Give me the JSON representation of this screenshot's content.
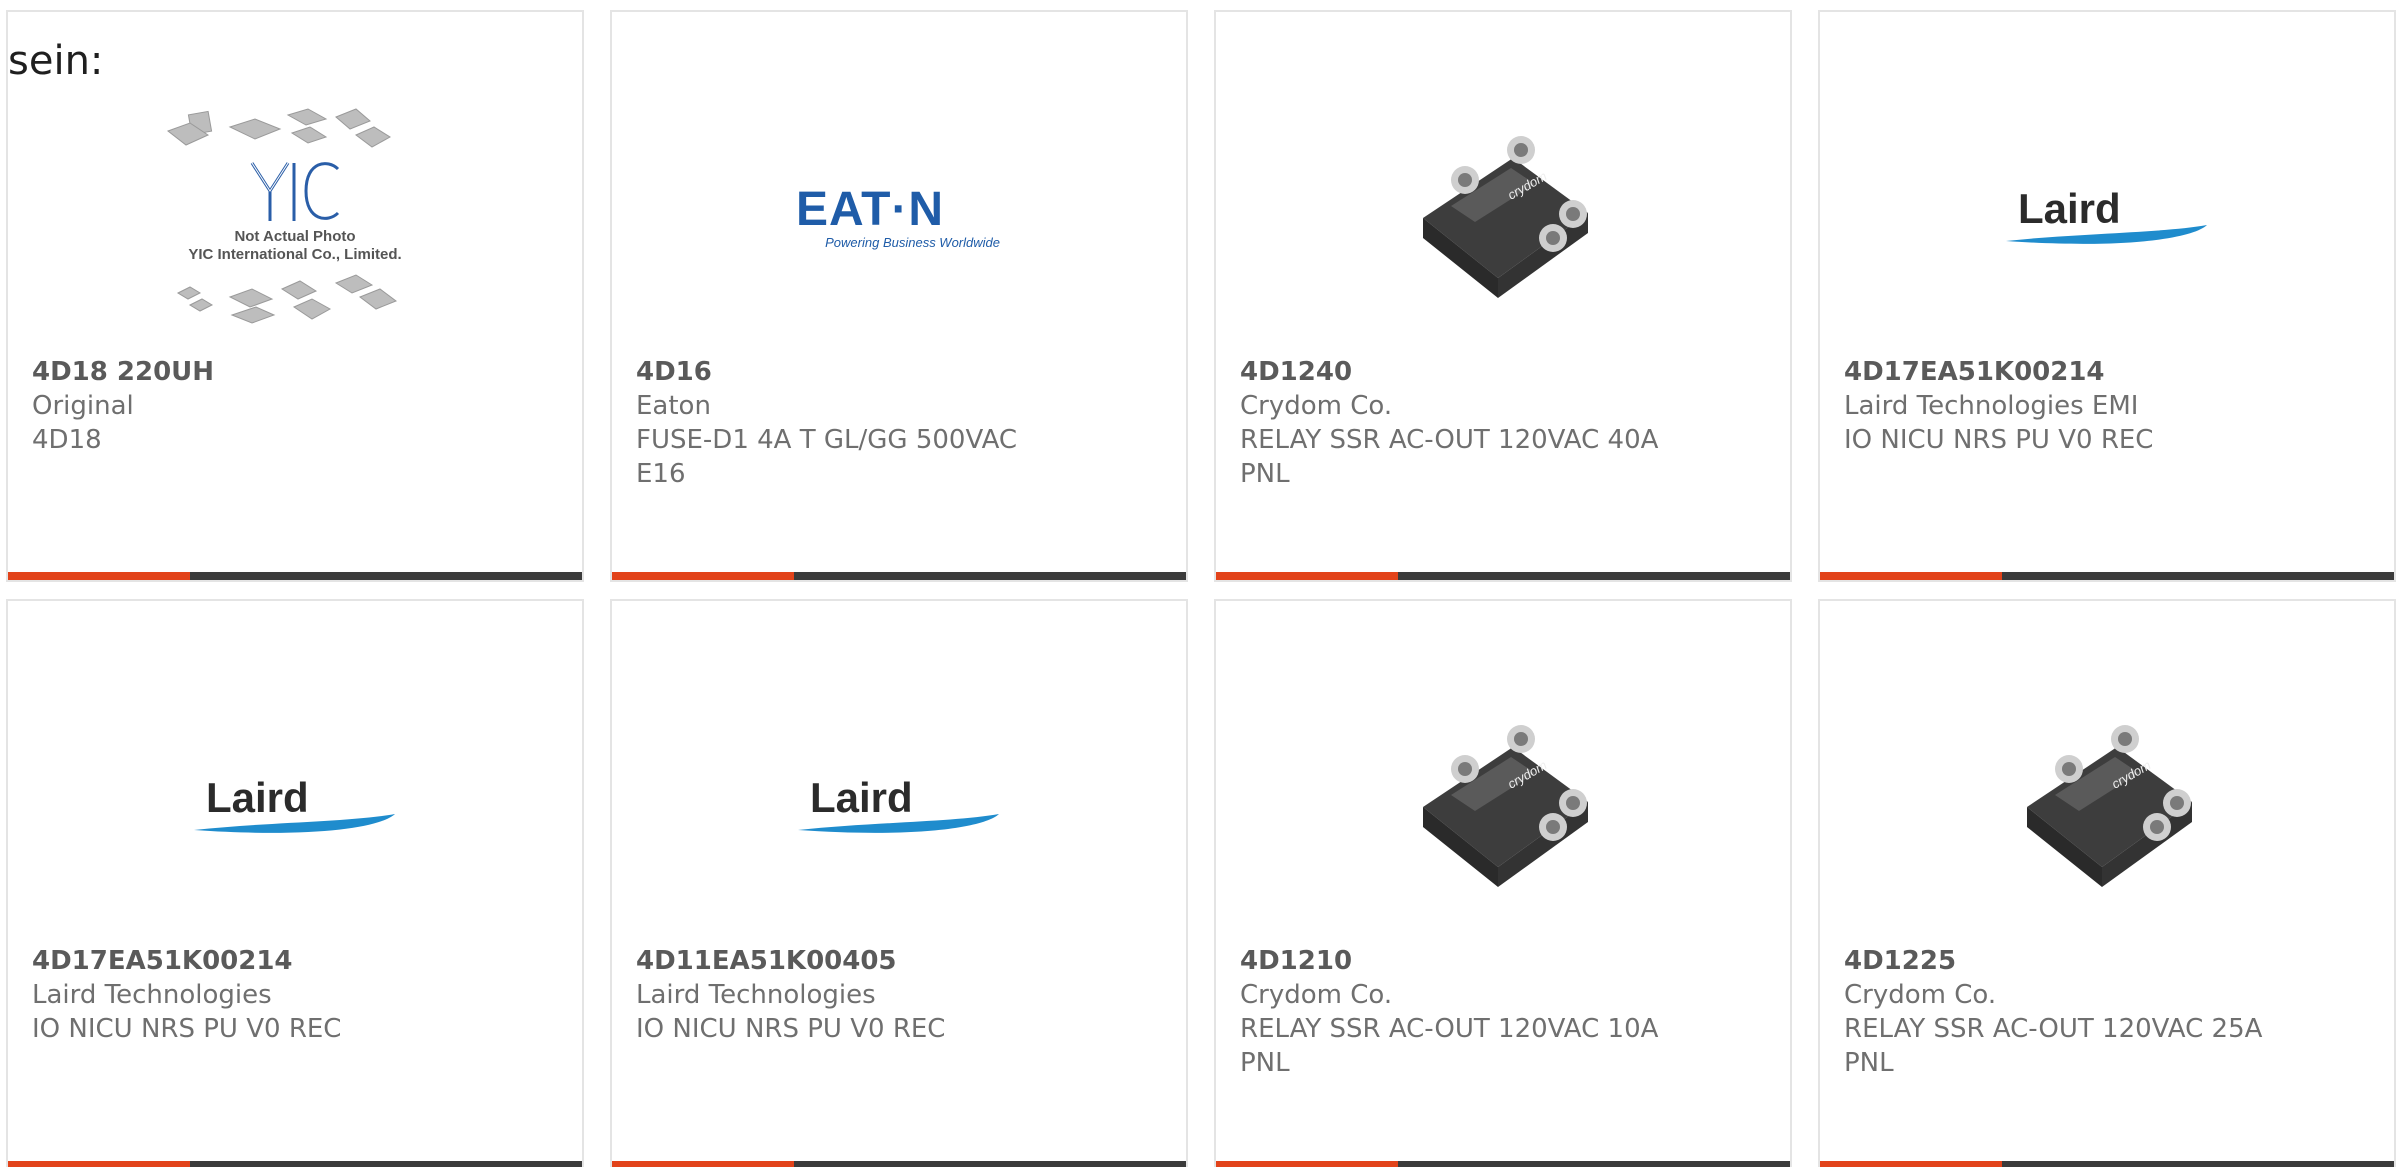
{
  "intro_text": "sein:",
  "products": [
    {
      "part": "4D18 220UH",
      "manufacturer": "Original",
      "description": "4D18",
      "image": "yic-placeholder",
      "placeholder_caption_1": "Not Actual Photo",
      "placeholder_caption_2": "YIC International Co., Limited.",
      "placeholder_logo": "YIC"
    },
    {
      "part": "4D16",
      "manufacturer": "Eaton",
      "description": "FUSE-D1 4A T GL/GG 500VAC E16",
      "image": "eaton-logo",
      "logo_text": "EAT·N",
      "logo_tagline": "Powering Business Worldwide"
    },
    {
      "part": "4D1240",
      "manufacturer": "Crydom Co.",
      "description": "RELAY SSR AC-OUT 120VAC 40A PNL",
      "image": "crydom-relay",
      "relay_brand": "crydom"
    },
    {
      "part": "4D17EA51K00214",
      "manufacturer": "Laird Technologies EMI",
      "description": "IO NICU NRS PU V0 REC",
      "image": "laird-logo",
      "logo_text": "Laird"
    },
    {
      "part": "4D17EA51K00214",
      "manufacturer": "Laird Technologies",
      "description": "IO NICU NRS PU V0 REC",
      "image": "laird-logo",
      "logo_text": "Laird"
    },
    {
      "part": "4D11EA51K00405",
      "manufacturer": "Laird Technologies",
      "description": "IO NICU NRS PU V0 REC",
      "image": "laird-logo",
      "logo_text": "Laird"
    },
    {
      "part": "4D1210",
      "manufacturer": "Crydom Co.",
      "description": "RELAY SSR AC-OUT 120VAC 10A PNL",
      "image": "crydom-relay",
      "relay_brand": "crydom"
    },
    {
      "part": "4D1225",
      "manufacturer": "Crydom Co.",
      "description": "RELAY SSR AC-OUT 120VAC 25A PNL",
      "image": "crydom-relay",
      "relay_brand": "crydom"
    }
  ],
  "colors": {
    "accent": "#e2431a",
    "bar_dark": "#3b3b3b",
    "text": "#6f6f6f",
    "eaton_blue": "#1f5ca8",
    "laird_blue": "#1f8ccd"
  }
}
